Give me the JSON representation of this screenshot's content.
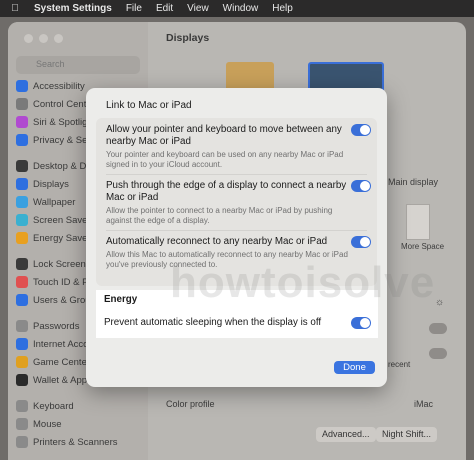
{
  "menubar": {
    "apple_icon": "apple-logo-icon",
    "app_name": "System Settings",
    "items": [
      "File",
      "Edit",
      "View",
      "Window",
      "Help"
    ]
  },
  "sidebar": {
    "search_placeholder": "Search",
    "items": [
      {
        "label": "Accessibility",
        "icon": "accessibility-icon",
        "color": "#2e6fe0"
      },
      {
        "label": "Control Centre",
        "icon": "control-centre-icon",
        "color": "#7a7a7a"
      },
      {
        "label": "Siri & Spotlight",
        "icon": "siri-icon",
        "color": "#b04ad0"
      },
      {
        "label": "Privacy & Security",
        "icon": "hand-icon",
        "color": "#2e6fe0"
      },
      {
        "label": "Desktop & Dock",
        "icon": "dock-icon",
        "color": "#3a3a3a"
      },
      {
        "label": "Displays",
        "icon": "display-icon",
        "color": "#2e6fe0"
      },
      {
        "label": "Wallpaper",
        "icon": "wallpaper-icon",
        "color": "#3aa0e0"
      },
      {
        "label": "Screen Saver",
        "icon": "screen-saver-icon",
        "color": "#3ab0d0"
      },
      {
        "label": "Energy Saver",
        "icon": "battery-icon",
        "color": "#e8a020"
      },
      {
        "label": "Lock Screen",
        "icon": "lock-icon",
        "color": "#3a3a3a"
      },
      {
        "label": "Touch ID & Password",
        "icon": "fingerprint-icon",
        "color": "#e05050"
      },
      {
        "label": "Users & Groups",
        "icon": "users-icon",
        "color": "#2e6fe0"
      },
      {
        "label": "Passwords",
        "icon": "key-icon",
        "color": "#8a8a8a"
      },
      {
        "label": "Internet Accounts",
        "icon": "at-icon",
        "color": "#2e6fe0"
      },
      {
        "label": "Game Center",
        "icon": "game-center-icon",
        "color": "#e0a020"
      },
      {
        "label": "Wallet & Apple Pay",
        "icon": "wallet-icon",
        "color": "#2a2a2a"
      },
      {
        "label": "Keyboard",
        "icon": "keyboard-icon",
        "color": "#8a8a8a"
      },
      {
        "label": "Mouse",
        "icon": "mouse-icon",
        "color": "#8a8a8a"
      },
      {
        "label": "Printers & Scanners",
        "icon": "printer-icon",
        "color": "#8a8a8a"
      }
    ]
  },
  "main": {
    "title": "Displays",
    "main_display_label": "Main display",
    "more_space_label": "More Space",
    "recent_label": "recent",
    "color_profile_label": "Color profile",
    "color_profile_value": "iMac",
    "advanced_button": "Advanced...",
    "night_shift_button": "Night Shift..."
  },
  "sheet": {
    "title": "Link to Mac or iPad",
    "rows": [
      {
        "label": "Allow your pointer and keyboard to move between any nearby Mac or iPad",
        "desc": "Your pointer and keyboard can be used on any nearby Mac or iPad signed in to your iCloud account.",
        "on": true
      },
      {
        "label": "Push through the edge of a display to connect a nearby Mac or iPad",
        "desc": "Allow the pointer to connect to a nearby Mac or iPad by pushing against the edge of a display.",
        "on": true
      },
      {
        "label": "Automatically reconnect to any nearby Mac or iPad",
        "desc": "Allow this Mac to automatically reconnect to any nearby Mac or iPad you've previously connected to.",
        "on": true
      }
    ],
    "energy": {
      "title": "Energy",
      "label": "Prevent automatic sleeping when the display is off",
      "on": true
    },
    "done_button": "Done"
  },
  "watermark": "howtoisolve",
  "colors": {
    "accent": "#3a6fd8",
    "done": "#3a74e0"
  }
}
